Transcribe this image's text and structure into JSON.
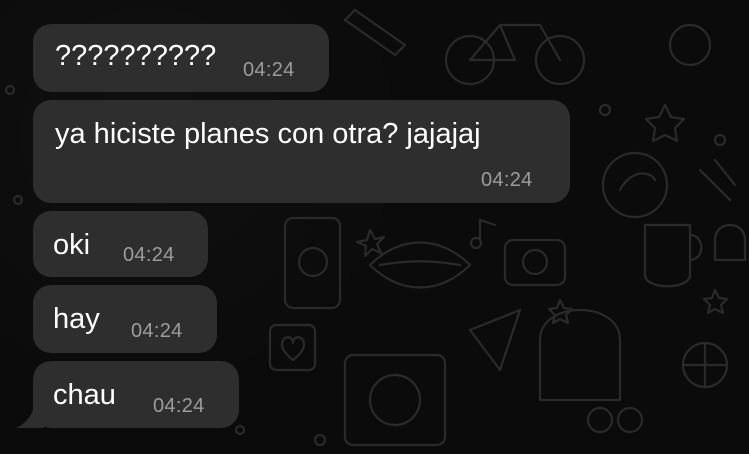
{
  "conversation": {
    "messages": [
      {
        "text": "??????????",
        "time": "04:24"
      },
      {
        "text": "ya hiciste planes con otra? jajajaj",
        "time": "04:24"
      },
      {
        "text": "oki",
        "time": "04:24"
      },
      {
        "text": "hay",
        "time": "04:24"
      },
      {
        "text": "chau",
        "time": "04:24"
      }
    ]
  },
  "colors": {
    "background": "#0b0b0b",
    "bubble": "#2e2e2e",
    "text": "#ffffff",
    "timestamp": "#9c9c9c"
  }
}
